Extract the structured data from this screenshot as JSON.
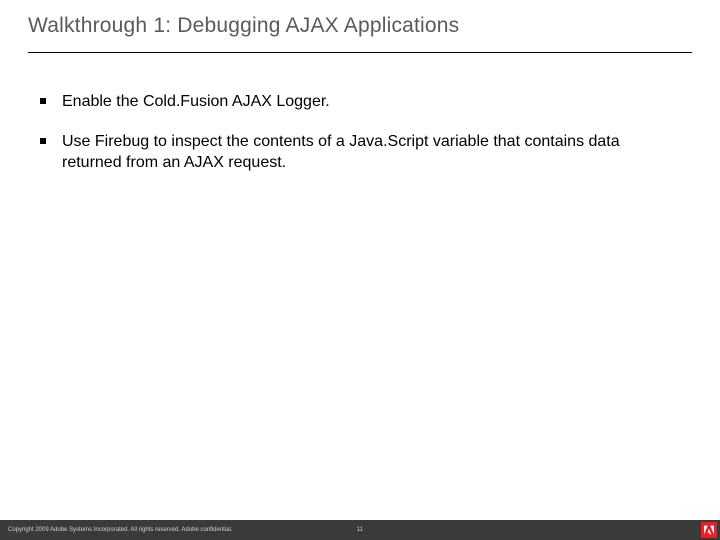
{
  "title": "Walkthrough 1: Debugging AJAX Applications",
  "bullets": [
    "Enable the Cold.Fusion AJAX Logger.",
    "Use Firebug to inspect the contents of a Java.Script variable that contains data returned from an AJAX request."
  ],
  "footer": {
    "copyright": "Copyright 2009 Adobe Systems Incorporated.  All rights reserved.  Adobe confidential.",
    "page_number": "11"
  }
}
